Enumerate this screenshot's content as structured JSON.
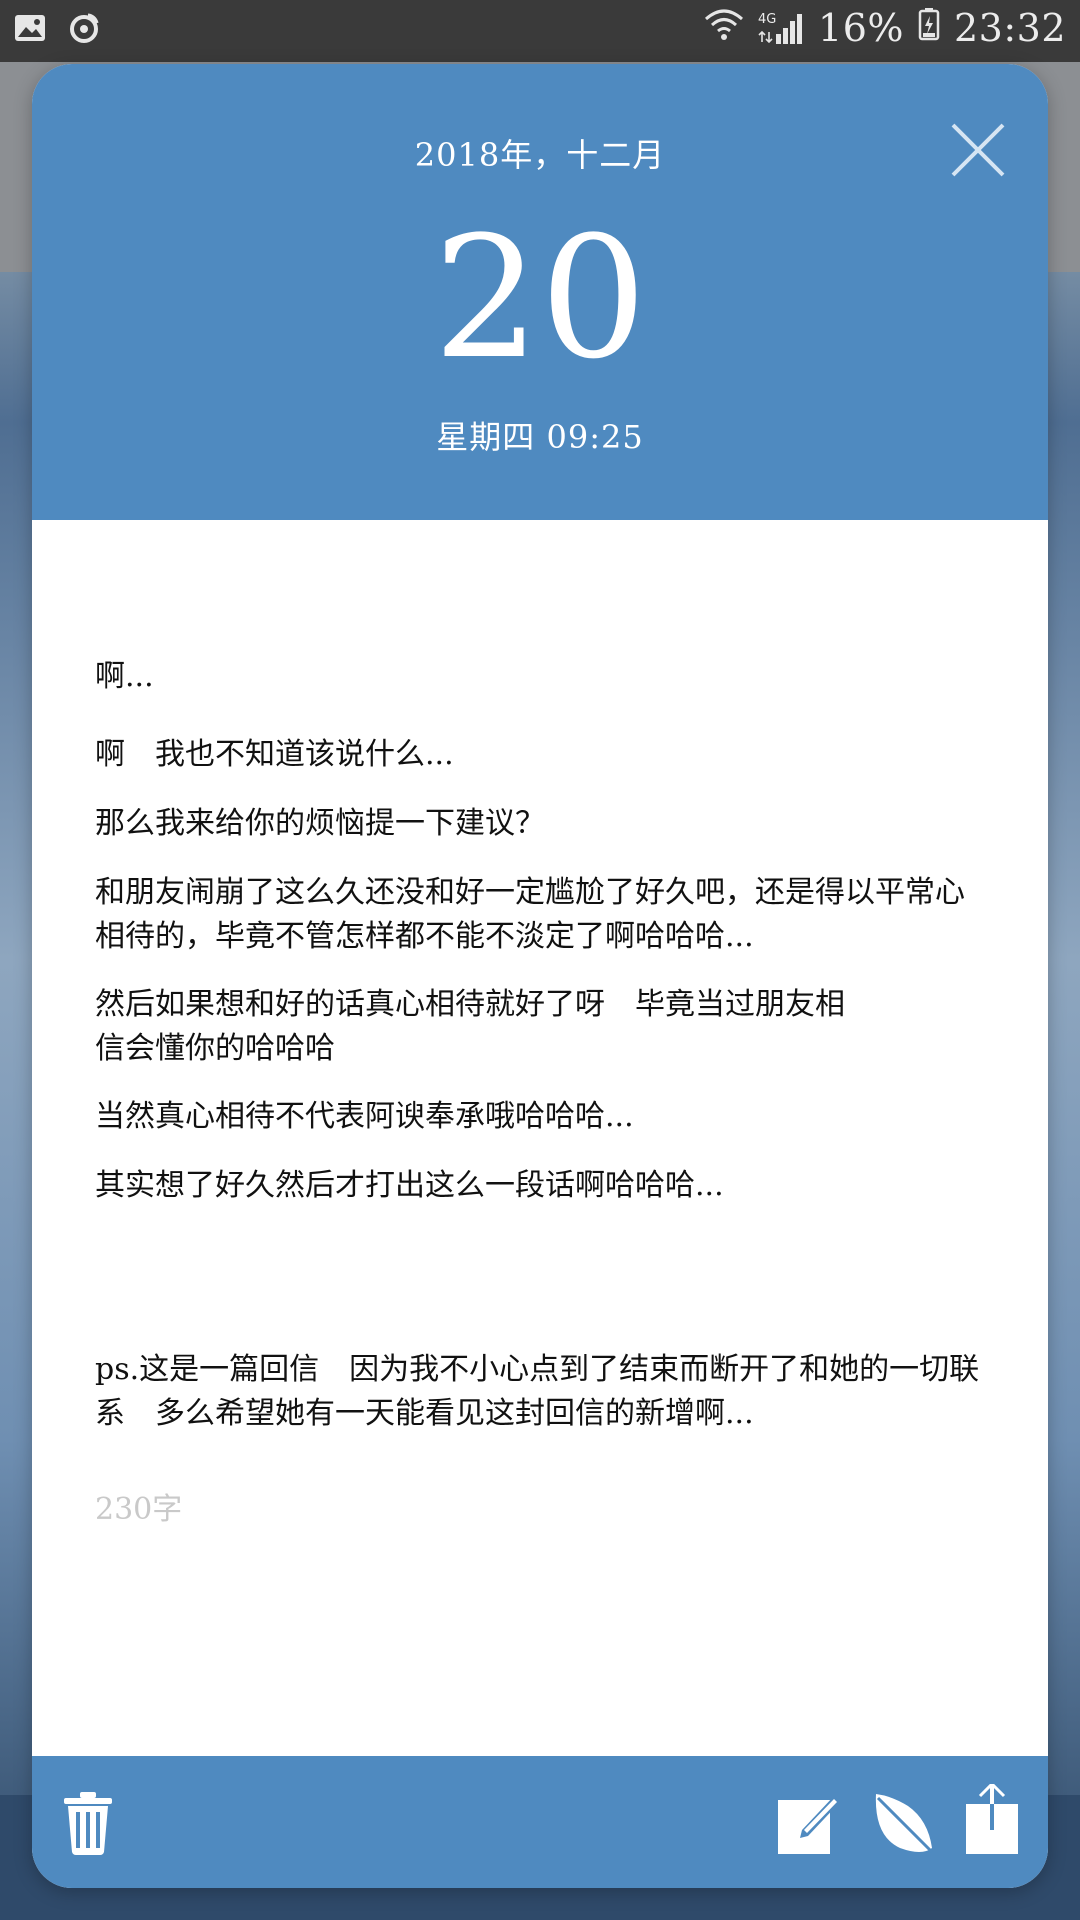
{
  "status_bar": {
    "network_label": "4G",
    "battery_percent": "16%",
    "time": "23:32",
    "left_icons": [
      "gallery-icon",
      "weibo-icon"
    ],
    "right_icons": [
      "wifi-icon",
      "signal-icon",
      "battery-icon"
    ]
  },
  "header": {
    "month_year": "2018年，十二月",
    "day": "20",
    "weekday_time": "星期四 09:25",
    "close_icon": "close-icon"
  },
  "colors": {
    "accent": "#4f8ac0",
    "status_bar": "#3a3a3a",
    "word_count": "#c9c9c9"
  },
  "content": {
    "paragraphs": [
      "啊...",
      "啊　我也不知道该说什么...",
      "那么我来给你的烦恼提一下建议？",
      "和朋友闹崩了这么久还没和好一定尴尬了好久吧，还是得以平常心相待的，毕竟不管怎样都不能不淡定了啊哈哈哈...",
      "然后如果想和好的话真心相待就好了呀　毕竟当过朋友相信会懂你的哈哈哈",
      "当然真心相待不代表阿谀奉承哦哈哈哈...",
      "其实想了好久然后才打出这么一段话啊哈哈哈...",
      "ps.这是一篇回信　因为我不小心点到了结束而断开了和她的一切联系　多么希望她有一天能看见这封回信的新增啊..."
    ],
    "word_count": "230字"
  },
  "footer": {
    "icons": [
      "trash-icon",
      "edit-icon",
      "leaf-icon",
      "share-icon"
    ]
  }
}
